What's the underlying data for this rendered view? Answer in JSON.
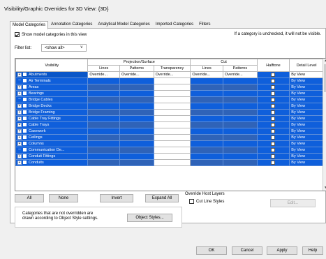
{
  "window": {
    "title": "Visibility/Graphic Overrides for 3D View: {3D}"
  },
  "tabs": [
    {
      "label": "Model Categories",
      "active": true
    },
    {
      "label": "Annotation Categories",
      "active": false
    },
    {
      "label": "Analytical Model Categories",
      "active": false
    },
    {
      "label": "Imported Categories",
      "active": false
    },
    {
      "label": "Filters",
      "active": false
    }
  ],
  "show_model_label": "Show model categories in this view",
  "hint": "If a category is unchecked, it will not be visible.",
  "filter": {
    "label": "Filter list:",
    "value": "<show all>"
  },
  "table": {
    "headers": {
      "visibility": "Visibility",
      "projection": "Projection/Surface",
      "cut": "Cut",
      "halftone": "Halftone",
      "detail": "Detail Level",
      "lines": "Lines",
      "patterns": "Patterns",
      "transparency": "Transparency",
      "cut_lines": "Lines",
      "cut_patterns": "Patterns"
    },
    "override_label": "Override...",
    "rows": [
      {
        "name": "Abutments",
        "expand": "+",
        "detail": "By View"
      },
      {
        "name": "Air Terminals",
        "expand": "",
        "detail": "By View"
      },
      {
        "name": "Areas",
        "expand": "+",
        "detail": "By View"
      },
      {
        "name": "Bearings",
        "expand": "+",
        "detail": "By View"
      },
      {
        "name": "Bridge Cables",
        "expand": "",
        "detail": "By View"
      },
      {
        "name": "Bridge Decks",
        "expand": "+",
        "detail": "By View"
      },
      {
        "name": "Bridge Framing",
        "expand": "+",
        "detail": "By View"
      },
      {
        "name": "Cable Tray Fittings",
        "expand": "+",
        "detail": "By View"
      },
      {
        "name": "Cable Trays",
        "expand": "+",
        "detail": "By View"
      },
      {
        "name": "Casework",
        "expand": "+",
        "detail": "By View"
      },
      {
        "name": "Ceilings",
        "expand": "+",
        "detail": "By View"
      },
      {
        "name": "Columns",
        "expand": "+",
        "detail": "By View"
      },
      {
        "name": "Communication De...",
        "expand": "",
        "detail": "By View"
      },
      {
        "name": "Conduit Fittings",
        "expand": "+",
        "detail": "By View"
      },
      {
        "name": "Conduits",
        "expand": "+",
        "detail": "By View"
      }
    ]
  },
  "buttons": {
    "all": "All",
    "none": "None",
    "invert": "Invert",
    "expand_all": "Expand All",
    "edit": "Edit...",
    "object_styles": "Object Styles...",
    "ok": "OK",
    "cancel": "Cancel",
    "apply": "Apply",
    "help": "Help"
  },
  "override_host": {
    "label": "Override Host Layers",
    "cut_line_styles": "Cut Line Styles"
  },
  "info_text": "Categories that are not overridden are drawn according to Object Style settings."
}
